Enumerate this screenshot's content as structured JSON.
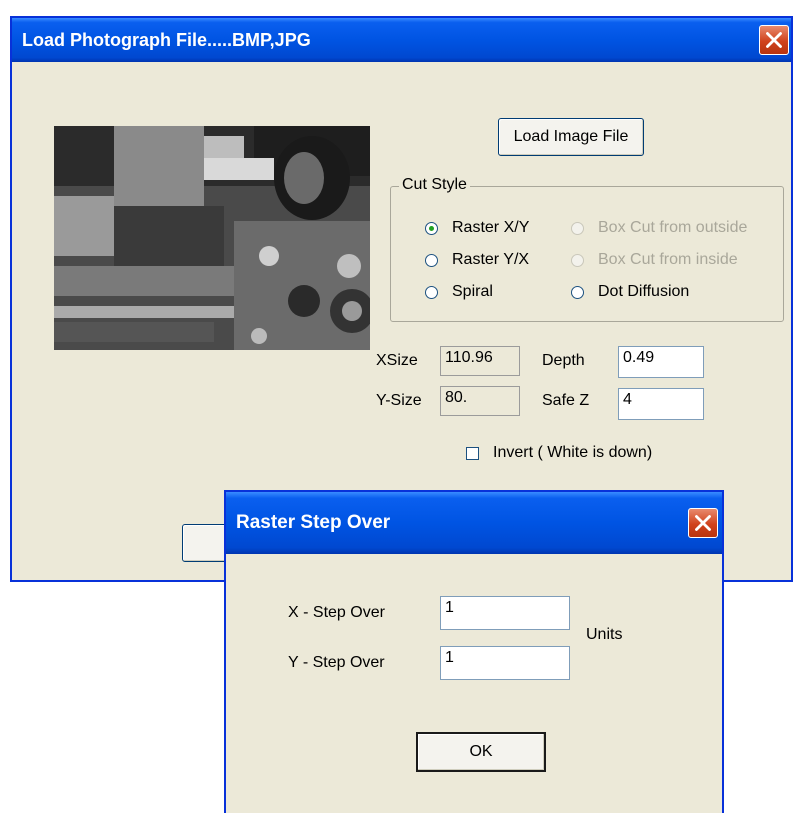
{
  "main_window": {
    "title": "Load Photograph File.....BMP,JPG",
    "load_button": "Load Image File",
    "cut_style": {
      "legend": "Cut Style",
      "options": [
        {
          "label": "Raster X/Y",
          "checked": true,
          "enabled": true
        },
        {
          "label": "Raster Y/X",
          "checked": false,
          "enabled": true
        },
        {
          "label": "Spiral",
          "checked": false,
          "enabled": true
        },
        {
          "label": "Box Cut from outside",
          "checked": false,
          "enabled": false
        },
        {
          "label": "Box Cut from inside",
          "checked": false,
          "enabled": false
        },
        {
          "label": "Dot Diffusion",
          "checked": false,
          "enabled": true
        }
      ]
    },
    "xsize_label": "XSize",
    "xsize_value": "110.96",
    "ysize_label": "Y-Size",
    "ysize_value": "80.",
    "depth_label": "Depth",
    "depth_value": "0.49",
    "safez_label": "Safe Z",
    "safez_value": "4",
    "invert_label": "Invert ( White is down)"
  },
  "dialog": {
    "title": "Raster Step Over",
    "x_step_label": "X - Step Over",
    "x_step_value": "1",
    "y_step_label": "Y - Step Over",
    "y_step_value": "1",
    "units_label": "Units",
    "ok_label": "OK"
  }
}
